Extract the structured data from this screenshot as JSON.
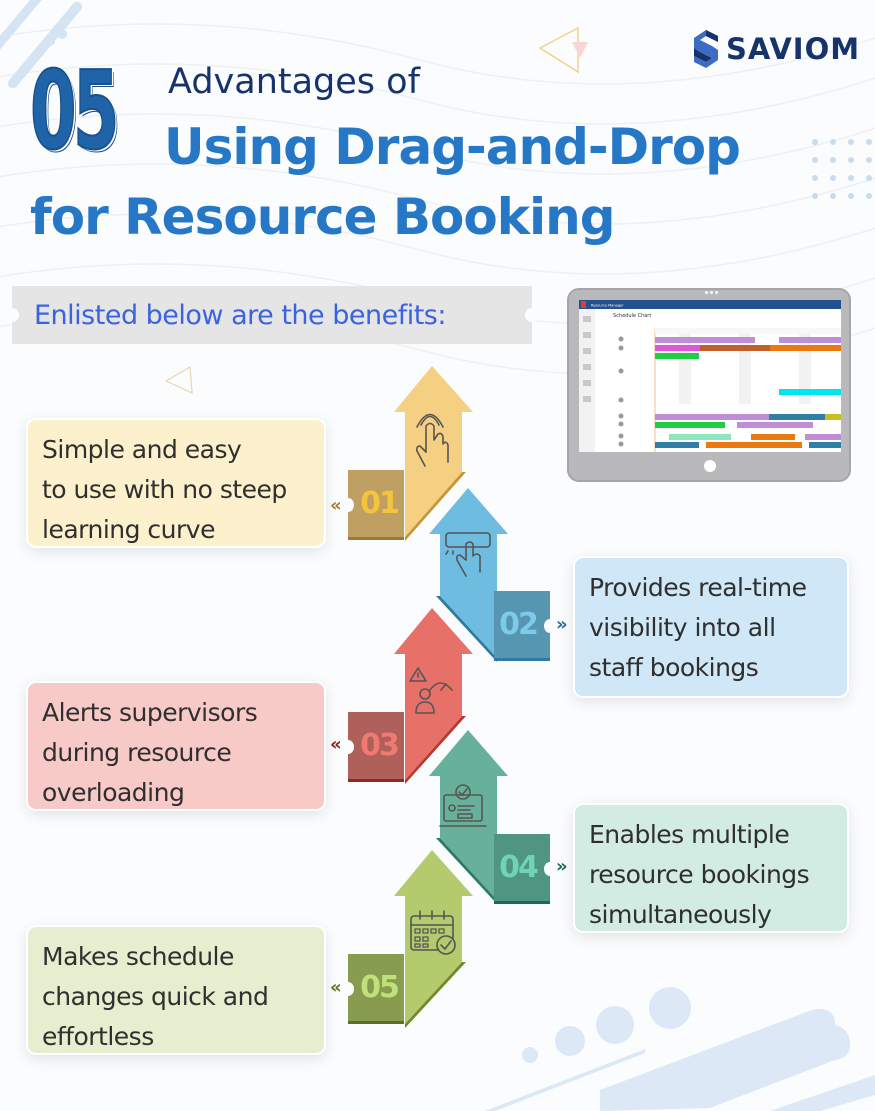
{
  "brand": {
    "logo_text": "SAVIOM",
    "logo_icon": "saviom-s-logo-icon"
  },
  "title": {
    "number": "05",
    "line1": "Advantages of",
    "line2": "Using Drag-and-Drop",
    "line3": "for Resource Booking"
  },
  "subtitle": "Enlisted below are the benefits:",
  "screenshot": {
    "app_name": "Resource Manager",
    "view_title": "Schedule Chart"
  },
  "benefits": [
    {
      "number": "01",
      "lines": [
        "Simple and easy",
        "to use with no steep",
        "learning curve"
      ],
      "icon": "tap-hand-icon",
      "side": "left",
      "colors": {
        "arrow": "#f5cf82",
        "tab": "#c0a062",
        "tab_text": "#f3c43e",
        "card": "#fdf0cc",
        "chevron": "#a47c2b"
      }
    },
    {
      "number": "02",
      "lines": [
        "Provides real-time",
        "visibility into all",
        "staff bookings"
      ],
      "icon": "button-click-icon",
      "side": "right",
      "colors": {
        "arrow": "#6ebde0",
        "tab": "#5796b1",
        "tab_text": "#7ccbe8",
        "card": "#cfe7f7",
        "chevron": "#1f6b8e"
      }
    },
    {
      "number": "03",
      "lines": [
        "Alerts supervisors",
        "during resource",
        "overloading"
      ],
      "icon": "overload-alert-icon",
      "side": "left",
      "colors": {
        "arrow": "#e77168",
        "tab": "#b0605a",
        "tab_text": "#ef7a70",
        "card": "#f7cac8",
        "chevron": "#8c1a16"
      }
    },
    {
      "number": "04",
      "lines": [
        "Enables multiple",
        "resource bookings",
        "simultaneously"
      ],
      "icon": "laptop-check-icon",
      "side": "right",
      "colors": {
        "arrow": "#67b19a",
        "tab": "#4f9582",
        "tab_text": "#6fd3b5",
        "card": "#d2ebe3",
        "chevron": "#1b6a52"
      }
    },
    {
      "number": "05",
      "lines": [
        "Makes schedule",
        "changes quick and",
        "effortless"
      ],
      "icon": "calendar-check-icon",
      "side": "left",
      "colors": {
        "arrow": "#b3cb6c",
        "tab": "#889c4f",
        "tab_text": "#bfe07a",
        "card": "#e5efcf",
        "chevron": "#5a7220"
      }
    }
  ],
  "chevrons": {
    "left": "«",
    "right": "»"
  }
}
